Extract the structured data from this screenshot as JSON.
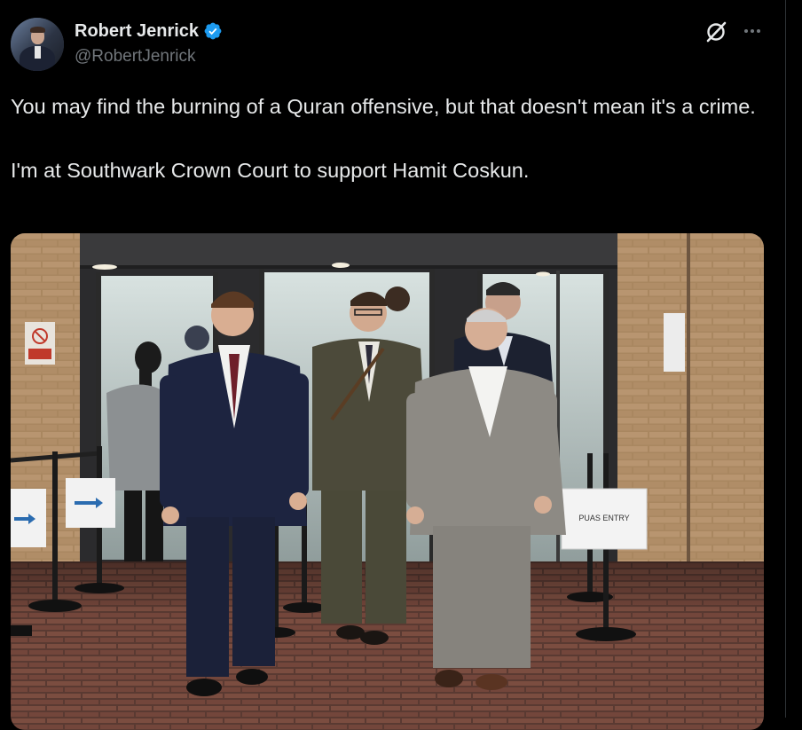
{
  "author": {
    "display_name": "Robert Jenrick",
    "handle": "@RobertJenrick",
    "verified": true,
    "avatar": "profile-photo"
  },
  "actions": {
    "grok_icon": "grok-icon",
    "more_icon": "more-options-icon"
  },
  "tweet": {
    "paragraphs": [
      "You may find the burning of a Quran offensive, but that doesn't mean it's a crime.",
      "I'm at Southwark Crown Court to support Hamit Coskun."
    ]
  },
  "media": {
    "type": "photo",
    "signs": {
      "entry": "PUAS ENTRY"
    }
  },
  "colors": {
    "background": "#000000",
    "text_primary": "#e7e9ea",
    "text_secondary": "#71767b",
    "verified_badge": "#1d9bf0"
  }
}
